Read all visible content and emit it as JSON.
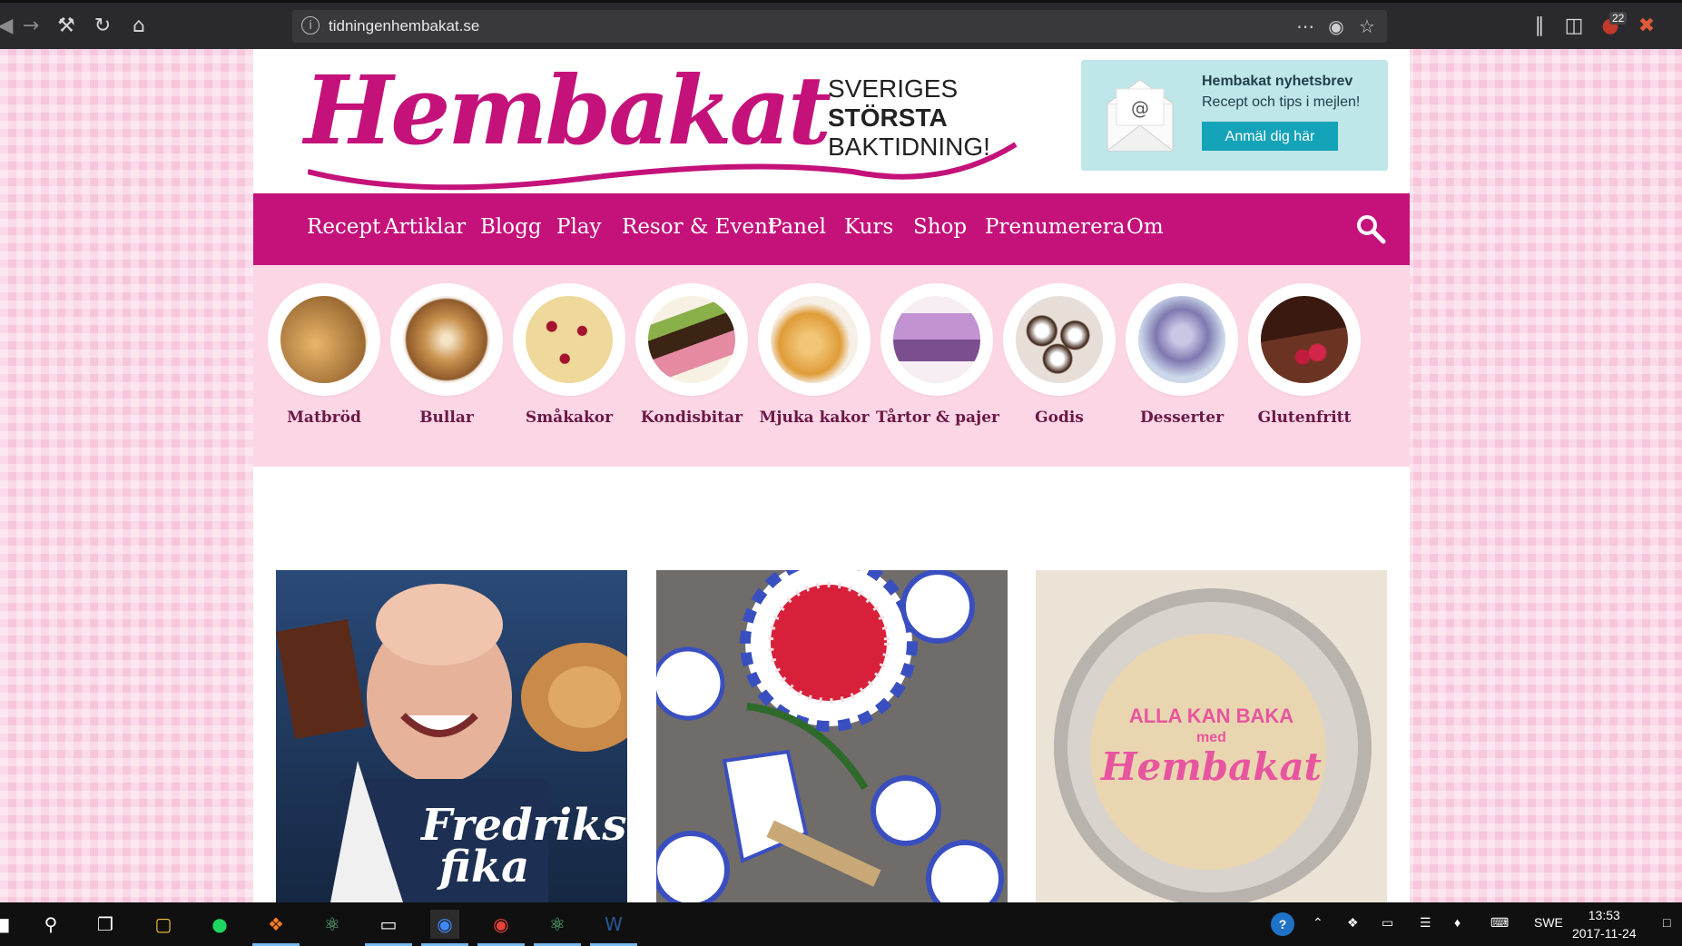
{
  "browser": {
    "url": "tidningenhembakat.se",
    "badge_count": "22",
    "icons": [
      "back-icon",
      "forward-icon",
      "tools-icon",
      "reload-icon",
      "home-icon",
      "info-icon",
      "more-icon",
      "pocket-icon",
      "star-icon",
      "library-icon",
      "sidebar-icon",
      "ublock-icon",
      "extension-icon"
    ]
  },
  "header": {
    "logo_text": "Hembakat",
    "tagline": [
      "SVERIGES",
      "STÖRSTA",
      "BAKTIDNING!"
    ],
    "newsletter": {
      "title": "Hembakat nyhetsbrev",
      "subtitle": "Recept och tips i mejlen!",
      "button": "Anmäl dig här"
    }
  },
  "nav": {
    "items": [
      "Recept",
      "Artiklar",
      "Blogg",
      "Play",
      "Resor & Event",
      "Panel",
      "Kurs",
      "Shop",
      "Prenumerera",
      "Om"
    ],
    "icon": "search-icon"
  },
  "categories": [
    {
      "label": "Matbröd",
      "color": "#d8a35a"
    },
    {
      "label": "Bullar",
      "color": "#c9924f"
    },
    {
      "label": "Småkakor",
      "color": "#eed89a"
    },
    {
      "label": "Kondisbitar",
      "color": "#5b3a1e"
    },
    {
      "label": "Mjuka kakor",
      "color": "#e7a64a"
    },
    {
      "label": "Tårtor & pajer",
      "color": "#b88ac8"
    },
    {
      "label": "Godis",
      "color": "#4a2a1a"
    },
    {
      "label": "Desserter",
      "color": "#8a86b8"
    },
    {
      "label": "Glutenfritt",
      "color": "#5a2a1e"
    }
  ],
  "cards": [
    {
      "title_line1": "Fredriks",
      "title_line2": "fika",
      "bg": "#1e3558"
    },
    {
      "bg": "#6f6c6a"
    },
    {
      "line1": "ALLA KAN BAKA",
      "line2": "med",
      "line3": "Hembakat",
      "bg": "#e9e2d6"
    }
  ],
  "taskbar": {
    "apps": [
      "start-icon",
      "search-icon",
      "task-view-icon",
      "file-explorer-icon",
      "spotify-icon",
      "xampp-icon",
      "atom-icon",
      "terminal-icon",
      "firefox-icon",
      "chrome-icon",
      "atom-icon",
      "word-icon"
    ],
    "language": "SWE",
    "time": "13:53",
    "date": "2017-11-24"
  }
}
